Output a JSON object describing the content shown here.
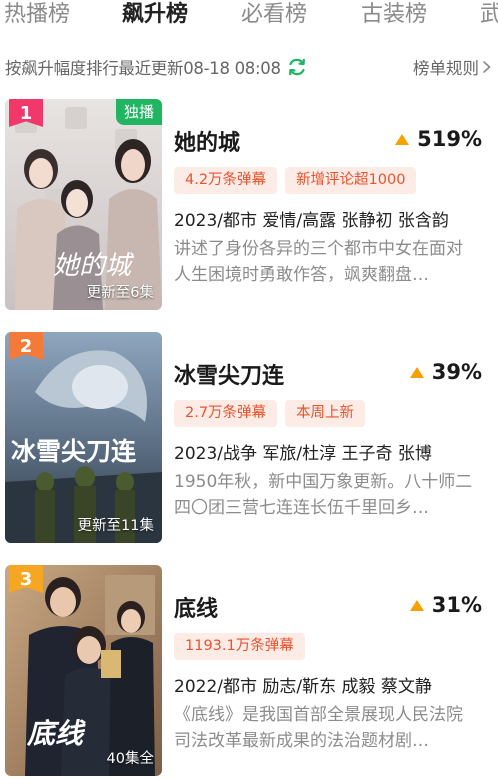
{
  "tabs": [
    {
      "label": "热播榜",
      "active": false
    },
    {
      "label": "飙升榜",
      "active": true
    },
    {
      "label": "必看榜",
      "active": false
    },
    {
      "label": "古装榜",
      "active": false
    },
    {
      "label": "武",
      "active": false
    }
  ],
  "subheader": {
    "text": "按飙升幅度排行最近更新08-18 08:08",
    "rules_label": "榜单规则"
  },
  "colors": {
    "accent_green": "#21b563",
    "rank1": "#f0386b",
    "rank2": "#f47a3a",
    "rank3": "#f5a623",
    "up_arrow": "#f5a100",
    "badge_text": "#e8532f"
  },
  "items": [
    {
      "rank": "1",
      "exclusive": "独播",
      "update": "更新至6集",
      "title": "她的城",
      "percent": "519%",
      "badges": [
        "4.2万条弹幕",
        "新增评论超1000"
      ],
      "meta": "2023/都市 爱情/高露 张静初 张含韵",
      "desc": "讲述了身份各异的三个都市中女在面对人生困境时勇敢作答，飒爽翻盘…"
    },
    {
      "rank": "2",
      "update": "更新至11集",
      "title": "冰雪尖刀连",
      "percent": "39%",
      "badges": [
        "2.7万条弹幕",
        "本周上新"
      ],
      "meta": "2023/战争 军旅/杜淳 王子奇 张博",
      "desc": "1950年秋，新中国万象更新。八十师二四〇团三营七连连长伍千里回乡…"
    },
    {
      "rank": "3",
      "update": "40集全",
      "title": "底线",
      "percent": "31%",
      "badges": [
        "1193.1万条弹幕"
      ],
      "meta": "2022/都市 励志/靳东 成毅 蔡文静",
      "desc": "《底线》是我国首部全景展现人民法院司法改革最新成果的法治题材剧…"
    }
  ]
}
